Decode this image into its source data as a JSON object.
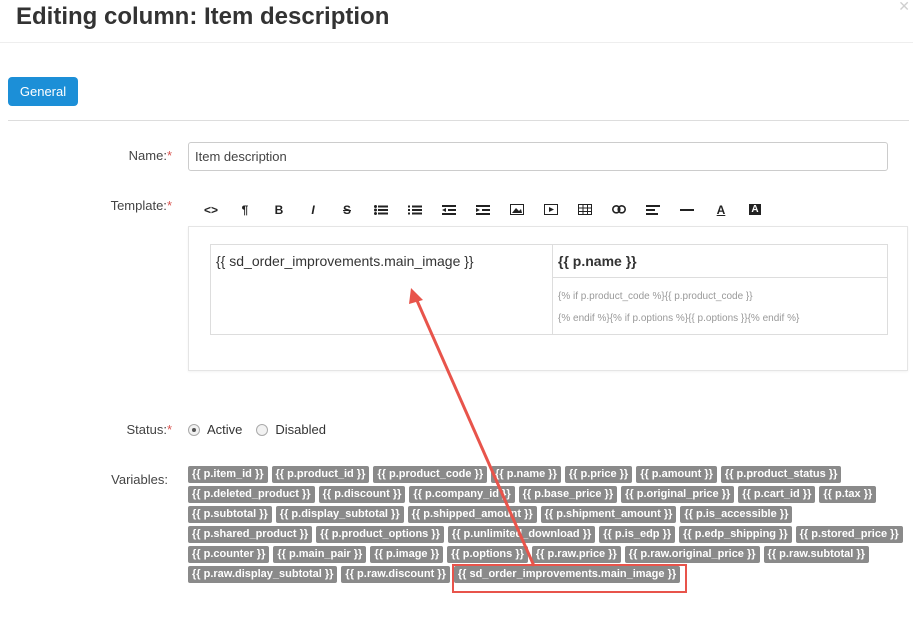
{
  "dialog": {
    "title": "Editing column: Item description",
    "close_icon": "close-icon"
  },
  "tabs": [
    {
      "label": "General",
      "active": true
    }
  ],
  "form": {
    "name": {
      "label": "Name:",
      "required_mark": "*",
      "value": "Item description"
    },
    "template": {
      "label": "Template:",
      "required_mark": "*",
      "toolbar": [
        {
          "name": "html-code-icon",
          "glyph": "<>"
        },
        {
          "name": "paragraph-icon",
          "glyph": "¶"
        },
        {
          "name": "bold-icon",
          "glyph": "B"
        },
        {
          "name": "italic-icon",
          "glyph": "I"
        },
        {
          "name": "strikethrough-icon",
          "glyph": "S"
        },
        {
          "name": "unordered-list-icon",
          "glyph": ""
        },
        {
          "name": "ordered-list-icon",
          "glyph": ""
        },
        {
          "name": "outdent-icon",
          "glyph": ""
        },
        {
          "name": "indent-icon",
          "glyph": ""
        },
        {
          "name": "image-icon",
          "glyph": ""
        },
        {
          "name": "video-icon",
          "glyph": ""
        },
        {
          "name": "table-icon",
          "glyph": ""
        },
        {
          "name": "link-icon",
          "glyph": ""
        },
        {
          "name": "align-icon",
          "glyph": ""
        },
        {
          "name": "horizontal-rule-icon",
          "glyph": ""
        },
        {
          "name": "font-color-icon",
          "glyph": "A"
        },
        {
          "name": "background-color-icon",
          "glyph": "A"
        }
      ],
      "content": {
        "main_image": "{{ sd_order_improvements.main_image }}",
        "name": "{{ p.name }}",
        "code_line1": "{% if p.product_code %}{{ p.product_code }}",
        "code_line2": "{% endif %}{% if p.options %}{{ p.options }}{% endif %}"
      }
    },
    "status": {
      "label": "Status:",
      "required_mark": "*",
      "options": [
        {
          "label": "Active",
          "checked": true
        },
        {
          "label": "Disabled",
          "checked": false
        }
      ]
    },
    "variables": {
      "label": "Variables:",
      "items": [
        "{{ p.item_id }}",
        "{{ p.product_id }}",
        "{{ p.product_code }}",
        "{{ p.name }}",
        "{{ p.price }}",
        "{{ p.amount }}",
        "{{ p.product_status }}",
        "{{ p.deleted_product }}",
        "{{ p.discount }}",
        "{{ p.company_id }}",
        "{{ p.base_price }}",
        "{{ p.original_price }}",
        "{{ p.cart_id }}",
        "{{ p.tax }}",
        "{{ p.subtotal }}",
        "{{ p.display_subtotal }}",
        "{{ p.shipped_amount }}",
        "{{ p.shipment_amount }}",
        "{{ p.is_accessible }}",
        "{{ p.shared_product }}",
        "{{ p.product_options }}",
        "{{ p.unlimited_download }}",
        "{{ p.is_edp }}",
        "{{ p.edp_shipping }}",
        "{{ p.stored_price }}",
        "{{ p.counter }}",
        "{{ p.main_pair }}",
        "{{ p.image }}",
        "{{ p.options }}",
        "{{ p.raw.price }}",
        "{{ p.raw.original_price }}",
        "{{ p.raw.subtotal }}",
        "{{ p.raw.display_subtotal }}",
        "{{ p.raw.discount }}",
        "{{ sd_order_improvements.main_image }}"
      ]
    }
  },
  "annotation": {
    "color": "#e8544b"
  }
}
